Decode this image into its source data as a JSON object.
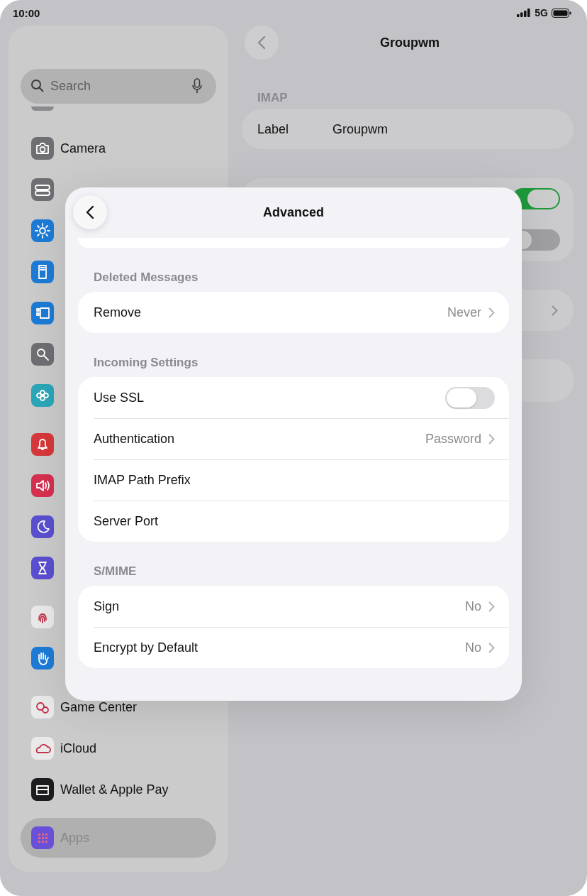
{
  "status_bar": {
    "time": "10:00",
    "network": "5G"
  },
  "sidebar": {
    "search": {
      "placeholder": "Search"
    },
    "groups": [
      [
        {
          "label": "Camera",
          "color": "#6e6e73"
        },
        {
          "color": "#6e6e73"
        },
        {
          "color": "#1d7bd6"
        },
        {
          "color": "#1d7bd6"
        },
        {
          "color": "#1d7bd6"
        },
        {
          "color": "#6e6e73"
        },
        {
          "color": "#2aa7b8"
        }
      ],
      [
        {
          "color": "#d6383a"
        },
        {
          "color": "#d6304f"
        },
        {
          "color": "#5a4fcf"
        },
        {
          "color": "#5a4fcf"
        }
      ],
      [
        {
          "color": "#e9e9ea"
        },
        {
          "color": "#1d7bd6"
        }
      ],
      [
        {
          "label": "Game Center",
          "color": "#e9e9ea"
        },
        {
          "label": "iCloud",
          "color": "#e9e9ea"
        },
        {
          "label": "Wallet & Apple Pay",
          "color": "#1c1c1e"
        }
      ]
    ],
    "selected_item": {
      "label": "Apps",
      "color": "#6a4fd8",
      "selected": true
    }
  },
  "detail": {
    "title": "Groupwm",
    "section": "IMAP",
    "label_row": {
      "label": "Label",
      "value": "Groupwm"
    },
    "toggles": [
      {
        "on": true
      },
      {
        "on": false
      }
    ]
  },
  "sheet": {
    "title": "Advanced",
    "sections": [
      {
        "header": "Deleted Messages",
        "rows": [
          {
            "kind": "value",
            "label": "Remove",
            "value": "Never"
          }
        ]
      },
      {
        "header": "Incoming Settings",
        "rows": [
          {
            "kind": "toggle",
            "label": "Use SSL",
            "on": false
          },
          {
            "kind": "value",
            "label": "Authentication",
            "value": "Password"
          },
          {
            "kind": "plain",
            "label": "IMAP Path Prefix"
          },
          {
            "kind": "plain",
            "label": "Server Port"
          }
        ]
      },
      {
        "header": "S/MIME",
        "rows": [
          {
            "kind": "value",
            "label": "Sign",
            "value": "No"
          },
          {
            "kind": "value",
            "label": "Encrypt by Default",
            "value": "No"
          }
        ]
      }
    ]
  }
}
